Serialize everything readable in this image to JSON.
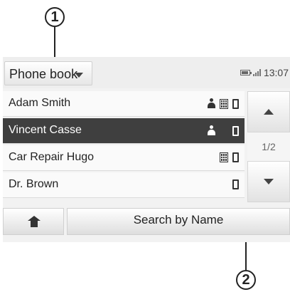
{
  "callouts": {
    "one": "1",
    "two": "2"
  },
  "header": {
    "dropdown_label": "Phone book",
    "time": "13:07",
    "icons": [
      "battery-icon",
      "signal-icon"
    ]
  },
  "contacts": [
    {
      "name": "Adam Smith",
      "icons": [
        "person-icon",
        "keypad-icon",
        "mobile-icon"
      ],
      "selected": false
    },
    {
      "name": "Vincent Casse",
      "icons": [
        "person-icon",
        "mobile-icon"
      ],
      "selected": true
    },
    {
      "name": "Car Repair Hugo",
      "icons": [
        "keypad-icon",
        "mobile-icon"
      ],
      "selected": false
    },
    {
      "name": "Dr. Brown",
      "icons": [
        "mobile-icon"
      ],
      "selected": false
    }
  ],
  "pagination": {
    "indicator": "1/2"
  },
  "bottom_bar": {
    "home_icon": "home-icon",
    "search_label": "Search by Name"
  },
  "colors": {
    "selected_row": "#3f3f3f",
    "background": "#f2f2f2"
  }
}
